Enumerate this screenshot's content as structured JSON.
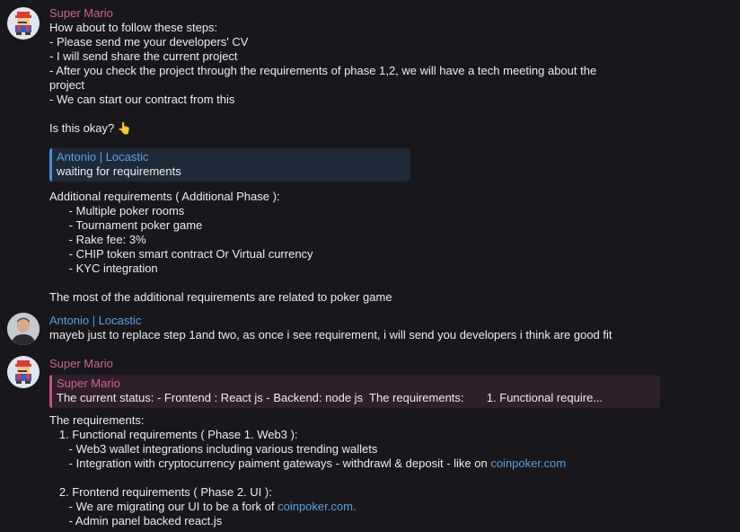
{
  "messages": [
    {
      "sender": "Super Mario",
      "lines": [
        "How about to follow these steps:",
        "- Please send me your developers' CV",
        "- I will send share the current project",
        "- After you check the project through the requirements of phase 1,2, we will have a tech meeting about the",
        "project",
        "- We can start our contract from this",
        "",
        "Is this okay? 👆"
      ],
      "quote": {
        "sender": "Antonio | Locastic",
        "text": "waiting for requirements"
      },
      "after_lines": [
        "Additional requirements ( Additional Phase ):",
        "      - Multiple poker rooms",
        "      - Tournament poker game",
        "      - Rake fee: 3%",
        "      - CHIP token smart contract Or Virtual currency",
        "      - KYC integration",
        "",
        "The most of the additional requirements are related to poker game"
      ]
    },
    {
      "sender": "Antonio | Locastic",
      "text": "mayeb just to replace step 1and two, as once i see requirement, i will send you developers i think are good fit"
    },
    {
      "sender": "Super Mario",
      "quote": {
        "sender": "Super Mario",
        "text": "The current status: - Frontend : React js - Backend: node js  The requirements:       1. Functional require..."
      },
      "lines": [
        "The requirements:",
        "   1. Functional requirements ( Phase 1. Web3 ):",
        "      - Web3 wallet integrations including various trending wallets",
        "      - Integration with cryptocurrency paiment gateways - withdrawl & deposit - like on ",
        "coinpoker.com",
        "   2. Frontend requirements ( Phase 2. UI ):",
        "      - We are migrating our UI to be a fork of ",
        "coinpoker.com.",
        "      - Admin panel backed react.js"
      ]
    }
  ]
}
